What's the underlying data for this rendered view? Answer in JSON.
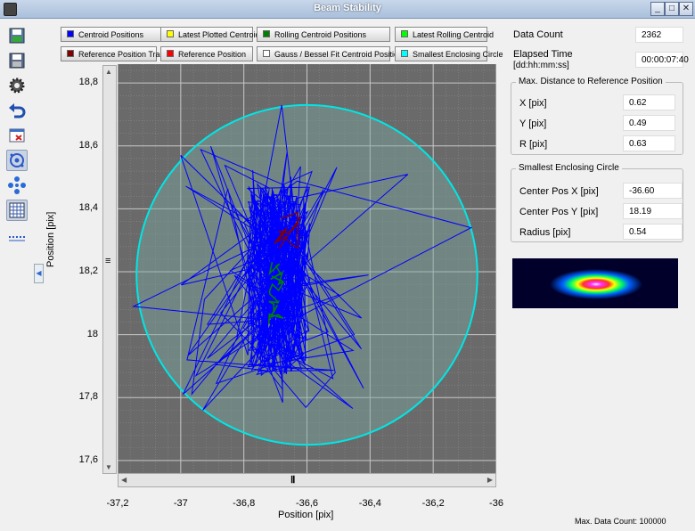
{
  "window": {
    "title": "Beam Stability",
    "minimize": "_",
    "maximize": "□",
    "close": "✕"
  },
  "toolbar": {
    "items": [
      "save-data-icon",
      "export-icon",
      "settings-gear-icon",
      "undo-icon",
      "clear-icon",
      "centroid-target-icon",
      "move-crosshair-icon",
      "grid-icon",
      "dotted-line-icon"
    ]
  },
  "legend": [
    {
      "label": "Centroid Positions",
      "color": "#0000ff"
    },
    {
      "label": "Latest Plotted Centroid",
      "color": "#ffff00"
    },
    {
      "label": "Rolling Centroid Positions",
      "color": "#008000"
    },
    {
      "label": "Latest Rolling Centroid",
      "color": "#00ff00"
    },
    {
      "label": "Reference Position Trace",
      "color": "#800000"
    },
    {
      "label": "Reference Position",
      "color": "#ff0000"
    },
    {
      "label": "Gauss / Bessel Fit Centroid Positions",
      "color": "#ffffff"
    },
    {
      "label": "Smallest Enclosing Circle",
      "color": "#00ffff"
    }
  ],
  "chart_data": {
    "type": "scatter",
    "xlabel": "Position [pix]",
    "ylabel": "Position [pix]",
    "xlim": [
      -37.2,
      -36.0
    ],
    "ylim": [
      17.56,
      18.86
    ],
    "x_ticks": [
      "-37,2",
      "-37",
      "-36,8",
      "-36,6",
      "-36,4",
      "-36,2",
      "-36"
    ],
    "x_tick_values": [
      -37.2,
      -37.0,
      -36.8,
      -36.6,
      -36.4,
      -36.2,
      -36.0
    ],
    "y_ticks": [
      "18,8",
      "18,6",
      "18,4",
      "18,2",
      "18",
      "17,8",
      "17,6"
    ],
    "y_tick_values": [
      18.8,
      18.6,
      18.4,
      18.2,
      18.0,
      17.8,
      17.6
    ],
    "grid": true,
    "circle": {
      "center_x": -36.6,
      "center_y": 18.19,
      "radius": 0.54,
      "color": "#00e6e6"
    },
    "series": [
      {
        "name": "Centroid Positions",
        "color": "#0000ff"
      },
      {
        "name": "Reference Position Trace",
        "color": "#800000"
      },
      {
        "name": "Rolling Centroid Positions",
        "color": "#008000"
      }
    ]
  },
  "stats": {
    "data_count_label": "Data Count",
    "data_count": "2362",
    "elapsed_label": "Elapsed Time",
    "elapsed_format": "[dd:hh:mm:ss]",
    "elapsed": "00:00:07:40"
  },
  "max_distance": {
    "title": "Max. Distance to Reference Position",
    "rows": [
      {
        "label": "X [pix]",
        "value": "0.62"
      },
      {
        "label": "Y [pix]",
        "value": "0.49"
      },
      {
        "label": "R [pix]",
        "value": "0.63"
      }
    ]
  },
  "enclosing_circle": {
    "title": "Smallest Enclosing Circle",
    "rows": [
      {
        "label": "Center Pos X [pix]",
        "value": "-36.60"
      },
      {
        "label": "Center Pos Y [pix]",
        "value": "18.19"
      },
      {
        "label": "Radius [pix]",
        "value": "0.54"
      }
    ]
  },
  "footer": "Max. Data Count: 100000"
}
